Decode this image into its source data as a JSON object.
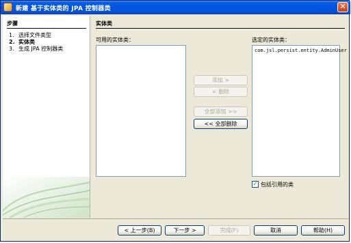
{
  "window": {
    "title": "新建 基于实体类的 JPA 控制器类",
    "close_symbol": "✕"
  },
  "steps": {
    "title": "步骤",
    "items": [
      {
        "num": "1.",
        "label": "选择文件类型"
      },
      {
        "num": "2.",
        "label": "实体类"
      },
      {
        "num": "3.",
        "label": "生成 JPA 控制器类"
      }
    ]
  },
  "main": {
    "title": "实体类",
    "available_label": "可用的实体类：",
    "selected_label": "选定的实体类：",
    "selected_items": [
      "com.jsl.persist.entity.AdminUser"
    ]
  },
  "transfer_buttons": {
    "add": "添加 >",
    "remove": "< 删除",
    "add_all": "全部添加 >>",
    "remove_all": "<< 全部删除"
  },
  "include_referenced": {
    "label": "包括引用的类",
    "checked_symbol": "✓",
    "checked": true
  },
  "footer": {
    "back": "< 上一步(B)",
    "next": "下一步 >",
    "finish": "完成(F)",
    "cancel": "取消",
    "help": "帮助(H)"
  }
}
